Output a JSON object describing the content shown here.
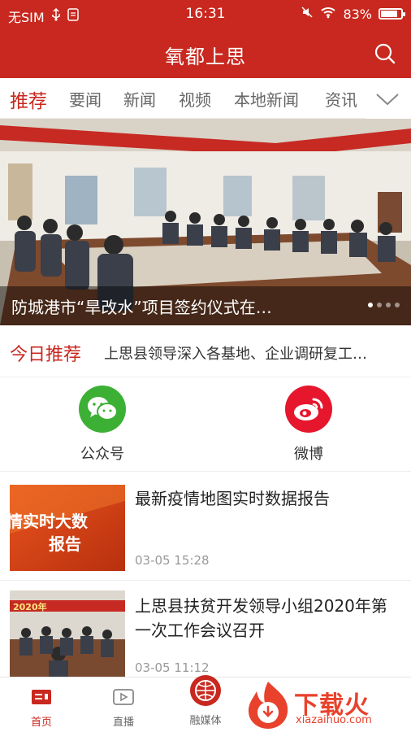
{
  "status_bar": {
    "carrier": "无SIM",
    "time": "16:31",
    "battery_percent": "83%",
    "battery_level": 0.83
  },
  "header": {
    "title": "氧都上思"
  },
  "tabs": [
    {
      "label": "推荐",
      "active": true
    },
    {
      "label": "要闻",
      "active": false
    },
    {
      "label": "新闻",
      "active": false
    },
    {
      "label": "视频",
      "active": false
    },
    {
      "label": "本地新闻",
      "active": false
    },
    {
      "label": "资讯",
      "active": false
    }
  ],
  "banner": {
    "caption": "防城港市“旱改水”项目签约仪式在…",
    "slide_count": 4,
    "active_slide": 1
  },
  "today": {
    "label": "今日推荐",
    "text": "上思县领导深入各基地、企业调研复工…"
  },
  "social": [
    {
      "name": "公众号",
      "icon": "wechat-icon",
      "color": "#3cb034"
    },
    {
      "name": "微博",
      "icon": "weibo-icon",
      "color": "#e6162d"
    }
  ],
  "news": [
    {
      "title": "最新疫情地图实时数据报告",
      "time": "03-05 15:28",
      "thumb_text": [
        "情实时大数",
        "报告"
      ]
    },
    {
      "title": "上思县扶贫开发领导小组2020年第一次工作会议召开",
      "time": "03-05 11:12",
      "thumb_text": [
        "2020年"
      ]
    }
  ],
  "bottom_nav": [
    {
      "label": "首页",
      "icon": "home-icon",
      "active": true
    },
    {
      "label": "直播",
      "icon": "live-icon",
      "active": false
    },
    {
      "label": "融媒体",
      "icon": "media-icon",
      "active": false
    }
  ],
  "watermark": {
    "brand": "下载火",
    "domain": "xiazaihuo.com"
  },
  "colors": {
    "brand_red": "#c8281f",
    "text_gray": "#666666"
  }
}
